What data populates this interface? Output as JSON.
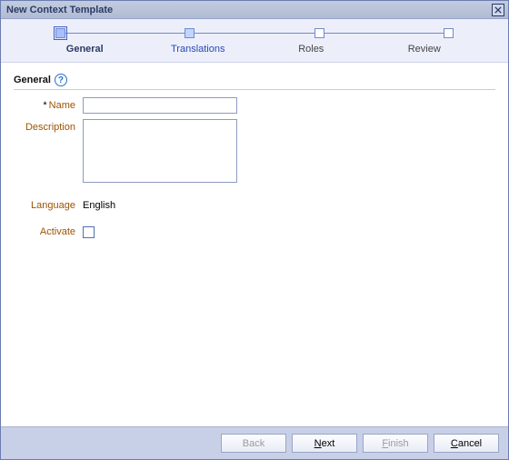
{
  "titlebar": {
    "title": "New Context Template"
  },
  "steps": {
    "general": "General",
    "translations": "Translations",
    "roles": "Roles",
    "review": "Review"
  },
  "section": {
    "header": "General"
  },
  "form": {
    "name_label": "Name",
    "name_value": "",
    "description_label": "Description",
    "description_value": "",
    "language_label": "Language",
    "language_value": "English",
    "activate_label": "Activate"
  },
  "buttons": {
    "back": "Back",
    "next": "Next",
    "finish": "Finish",
    "cancel": "Cancel"
  }
}
